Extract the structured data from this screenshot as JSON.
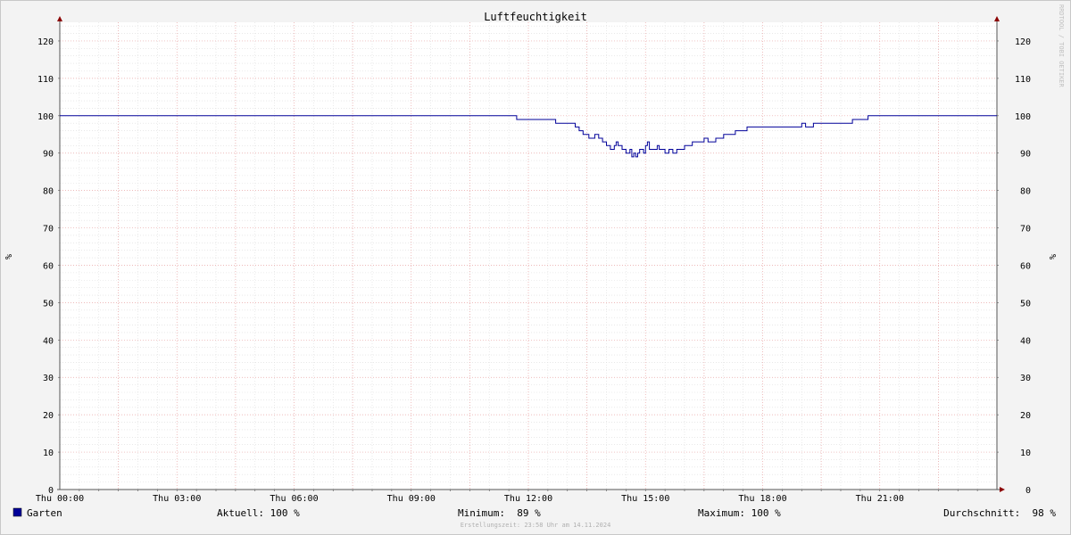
{
  "chart_data": {
    "type": "line",
    "title": "Luftfeuchtigkeit",
    "ylabel": "%",
    "ylim": [
      0,
      125
    ],
    "yticks": [
      0,
      10,
      20,
      30,
      40,
      50,
      60,
      70,
      80,
      90,
      100,
      110,
      120
    ],
    "xlim": [
      0,
      24
    ],
    "xticks": [
      {
        "t": 0,
        "label": "Thu 00:00"
      },
      {
        "t": 3,
        "label": "Thu 03:00"
      },
      {
        "t": 6,
        "label": "Thu 06:00"
      },
      {
        "t": 9,
        "label": "Thu 09:00"
      },
      {
        "t": 12,
        "label": "Thu 12:00"
      },
      {
        "t": 15,
        "label": "Thu 15:00"
      },
      {
        "t": 18,
        "label": "Thu 18:00"
      },
      {
        "t": 21,
        "label": "Thu 21:00"
      }
    ],
    "grid": true,
    "series": [
      {
        "name": "Garten",
        "color": "#000099",
        "x": [
          0,
          11.7,
          11.7,
          12.7,
          12.7,
          13.1,
          13.2,
          13.3,
          13.4,
          13.55,
          13.7,
          13.8,
          13.9,
          14.0,
          14.1,
          14.2,
          14.25,
          14.3,
          14.4,
          14.5,
          14.6,
          14.65,
          14.7,
          14.75,
          14.8,
          14.85,
          14.9,
          14.95,
          15.0,
          15.05,
          15.1,
          15.2,
          15.3,
          15.35,
          15.4,
          15.5,
          15.6,
          15.7,
          15.8,
          15.9,
          16.0,
          16.1,
          16.2,
          16.3,
          16.35,
          16.5,
          16.6,
          16.8,
          17.0,
          17.3,
          17.6,
          18.0,
          18.5,
          19.0,
          19.1,
          19.3,
          20.0,
          20.3,
          20.7,
          24
        ],
        "y": [
          100,
          100,
          99,
          99,
          98,
          98,
          97,
          96,
          95,
          94,
          95,
          94,
          93,
          92,
          91,
          92,
          93,
          92,
          91,
          90,
          91,
          89,
          90,
          89,
          90,
          91,
          91,
          90,
          92,
          93,
          91,
          91,
          92,
          91,
          91,
          90,
          91,
          90,
          91,
          91,
          92,
          92,
          93,
          93,
          93,
          94,
          93,
          94,
          95,
          96,
          97,
          97,
          97,
          98,
          97,
          98,
          98,
          99,
          100,
          100
        ]
      }
    ]
  },
  "legend": {
    "series_label": "Garten",
    "current": "Aktuell: 100 %",
    "minimum": "Minimum:  89 %",
    "maximum": "Maximum: 100 %",
    "average": "Durchschnitt:  98 %"
  },
  "footer": "Erstellungszeit: 23:58 Uhr am 14.11.2024",
  "watermark": "RRDTOOL / TOBI OETIKER"
}
